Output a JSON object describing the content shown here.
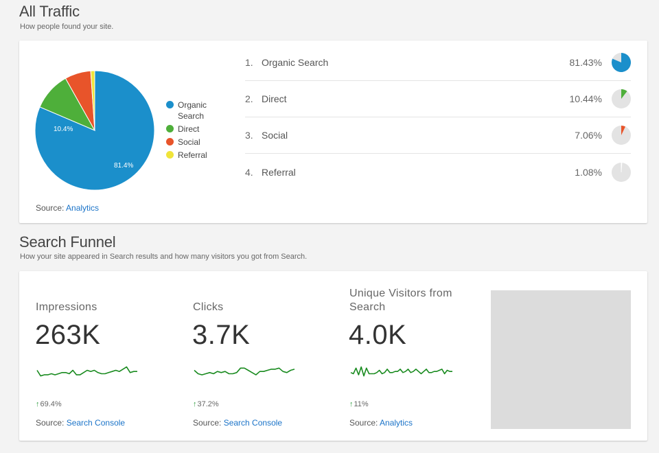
{
  "all_traffic": {
    "title": "All Traffic",
    "subtitle": "How people found your site.",
    "source_label": "Source:",
    "source_link": "Analytics",
    "pie_labels": {
      "organic": "81.4%",
      "direct": "10.4%"
    },
    "channels": [
      {
        "rank": "1.",
        "name": "Organic Search",
        "legend": "Organic Search",
        "percent": "81.43%",
        "value": 81.43,
        "color": "#1b8fcb"
      },
      {
        "rank": "2.",
        "name": "Direct",
        "legend": "Direct",
        "percent": "10.44%",
        "value": 10.44,
        "color": "#4eaf3a"
      },
      {
        "rank": "3.",
        "name": "Social",
        "legend": "Social",
        "percent": "7.06%",
        "value": 7.06,
        "color": "#e8542a"
      },
      {
        "rank": "4.",
        "name": "Referral",
        "legend": "Referral",
        "percent": "1.08%",
        "value": 1.08,
        "color": "#f0e43a"
      }
    ],
    "mini_pie_track_color": "#e3e3e3"
  },
  "search_funnel": {
    "title": "Search Funnel",
    "subtitle": "How your site appeared in Search results and how many visitors you got from Search.",
    "spark_color": "#188a1e",
    "metrics": [
      {
        "title": "Impressions",
        "value": "263K",
        "change": "69.4%",
        "source_label": "Source:",
        "source_link": "Search Console",
        "spark": [
          7,
          2,
          3,
          3,
          4,
          3,
          4,
          5,
          5,
          4,
          7,
          3,
          3,
          5,
          7,
          6,
          7,
          5,
          4,
          4,
          5,
          6,
          7,
          6,
          8,
          10,
          5,
          6,
          6
        ]
      },
      {
        "title": "Clicks",
        "value": "3.7K",
        "change": "37.2%",
        "source_label": "Source:",
        "source_link": "Search Console",
        "spark": [
          7,
          4,
          3,
          4,
          5,
          4,
          6,
          5,
          6,
          4,
          4,
          5,
          9,
          9,
          7,
          5,
          3,
          6,
          6,
          7,
          8,
          8,
          9,
          6,
          5,
          7,
          8
        ]
      },
      {
        "title": "Unique Visitors from Search",
        "value": "4.0K",
        "change": "11%",
        "source_label": "Source:",
        "source_link": "Analytics",
        "spark": [
          5,
          4,
          9,
          3,
          10,
          2,
          9,
          4,
          4,
          4,
          5,
          7,
          4,
          5,
          8,
          5,
          5,
          6,
          6,
          8,
          5,
          6,
          8,
          5,
          6,
          8,
          6,
          4,
          6,
          8,
          5,
          5,
          6,
          6,
          7,
          8,
          4,
          7,
          6,
          6
        ]
      }
    ]
  }
}
